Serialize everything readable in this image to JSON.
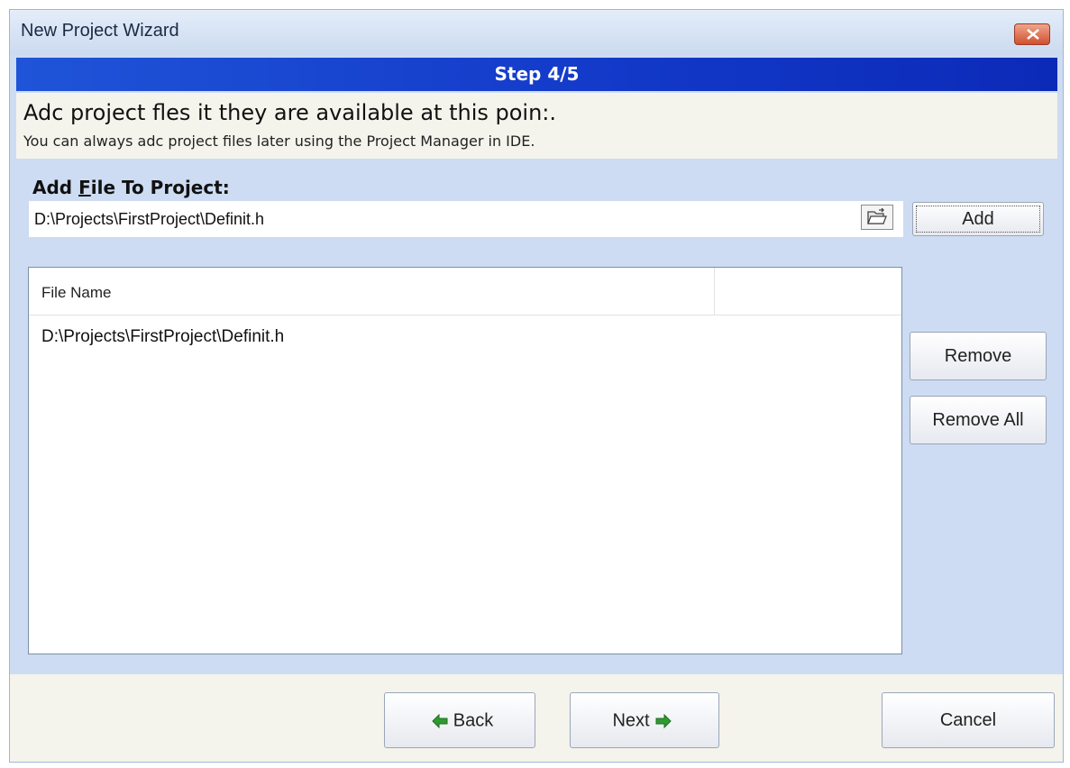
{
  "window": {
    "title": "New Project Wizard"
  },
  "step": {
    "label": "Step 4/5"
  },
  "info": {
    "main": "Adc project fles it they are available at this poin:.",
    "sub": "You can always adc project files later using the Project Manager in IDE."
  },
  "add_file": {
    "label_prefix": "Add ",
    "label_accel": "F",
    "label_rest": "ile To Project:",
    "path_value": "D:\\Projects\\FirstProject\\Definit.h",
    "add_button": "Add"
  },
  "file_list": {
    "column_header": "File Name",
    "rows": [
      "D:\\Projects\\FirstProject\\Definit.h"
    ]
  },
  "side_buttons": {
    "remove": "Remove",
    "remove_all": "Remove All"
  },
  "footer": {
    "back": "Back",
    "next": "Next",
    "cancel": "Cancel"
  },
  "colors": {
    "step_bar": "#1f54d8",
    "window_bg": "#cddcf2",
    "close_button": "#d0512f",
    "arrow_green": "#2f9a2f"
  },
  "icons": {
    "close": "close-icon",
    "browse": "open-folder-icon",
    "back": "arrow-left-icon",
    "next": "arrow-right-icon"
  }
}
